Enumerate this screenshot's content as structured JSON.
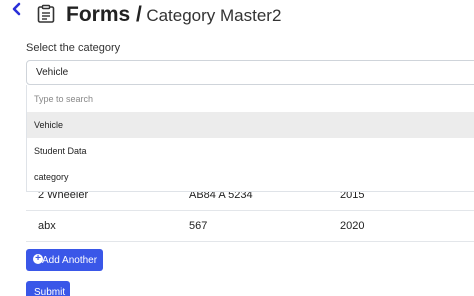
{
  "header": {
    "title_bold": "Forms /",
    "title_sub": "Category Master2"
  },
  "form": {
    "select_label": "Select the category",
    "selected_value": "Vehicle",
    "search_placeholder": "Type to search",
    "options": [
      "Vehicle",
      "Student Data",
      "category"
    ]
  },
  "table": {
    "rows": [
      [
        "2 Wheeler",
        "AB84 A 5234",
        "2015"
      ],
      [
        "abx",
        "567",
        "2020"
      ]
    ]
  },
  "buttons": {
    "add_label": "Add Another",
    "submit_label": "Submit"
  },
  "colors": {
    "primary": "#3a57e8",
    "back_arrow": "#2a2fd8"
  },
  "icons": {
    "back": "chevron-left-icon",
    "form": "clipboard-list-icon",
    "add": "plus-circle-icon"
  }
}
